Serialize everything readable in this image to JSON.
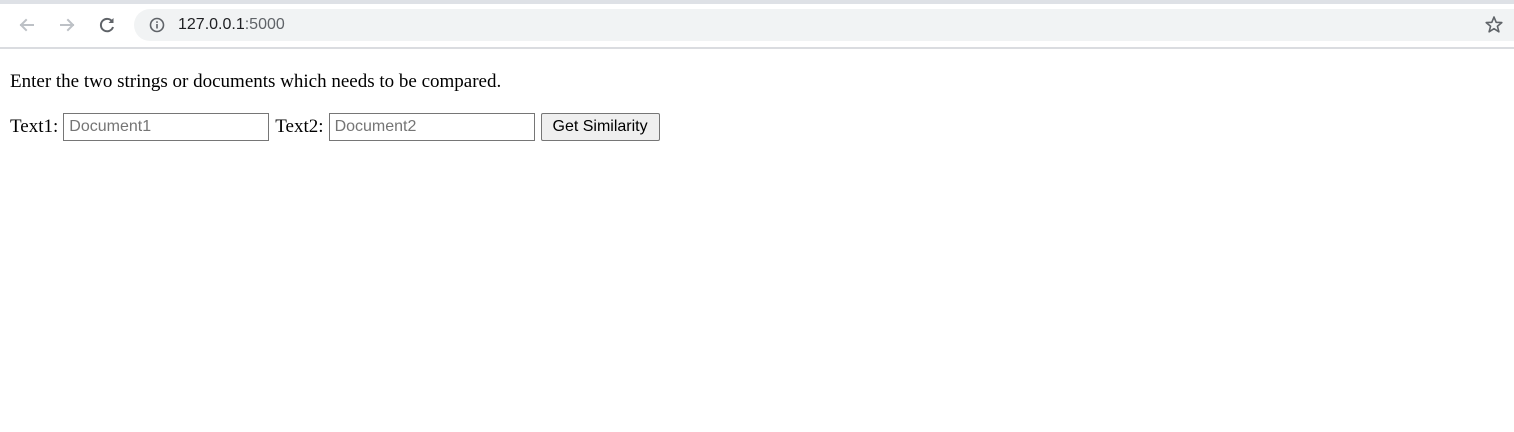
{
  "browser": {
    "url_host": "127.0.0.1",
    "url_port": ":5000",
    "icons": {
      "back": "back-arrow-icon",
      "forward": "forward-arrow-icon",
      "reload": "reload-icon",
      "site_info": "info-icon",
      "bookmark": "star-icon"
    }
  },
  "page": {
    "intro_text": "Enter the two strings or documents which needs to be compared.",
    "text1_label": "Text1:",
    "text1_placeholder": "Document1",
    "text1_value": "",
    "text2_label": "Text2:",
    "text2_placeholder": "Document2",
    "text2_value": "",
    "submit_label": "Get Similarity"
  }
}
